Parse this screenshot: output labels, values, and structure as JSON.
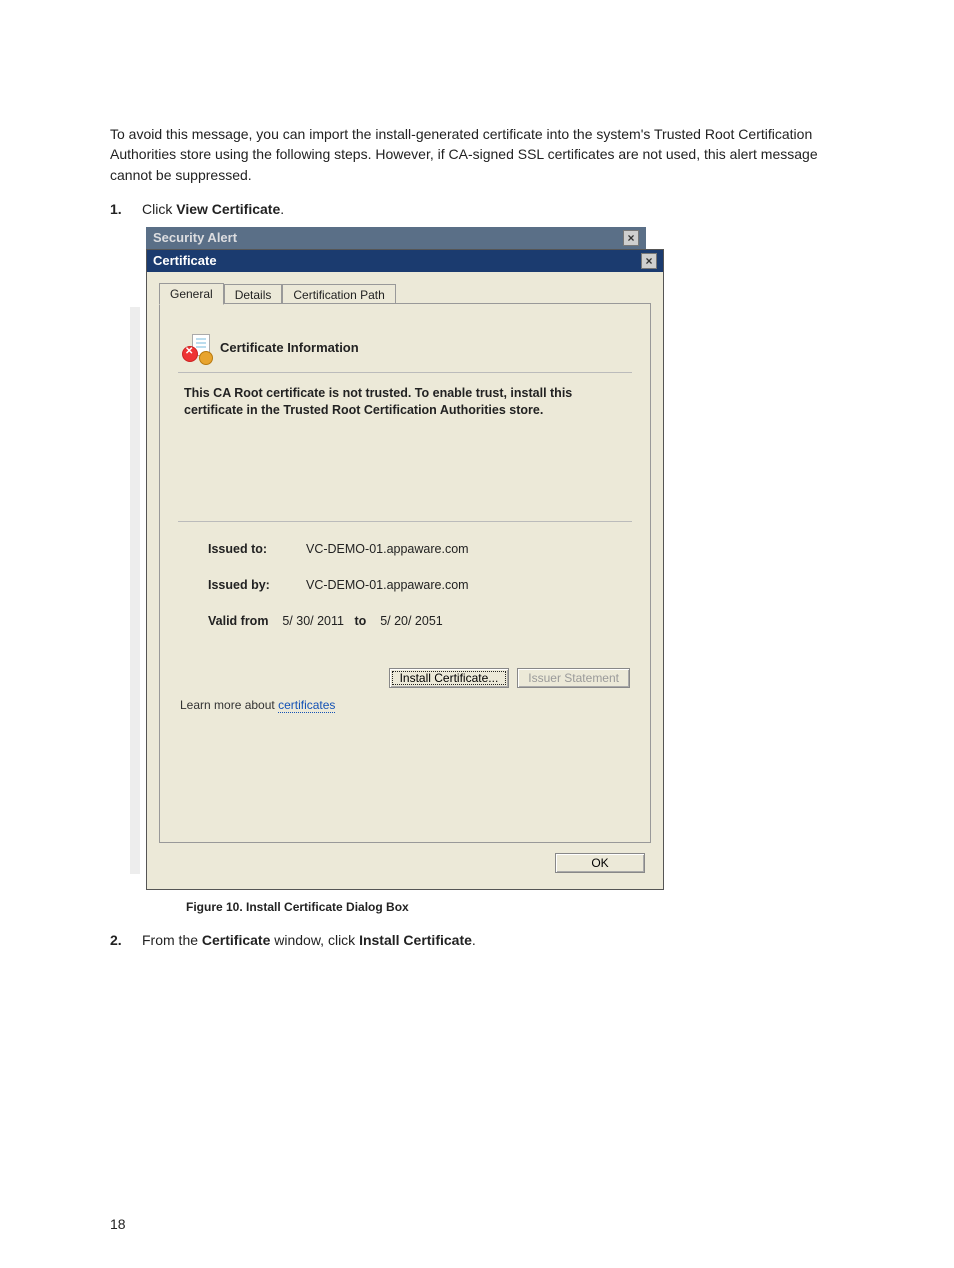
{
  "intro_text": "To avoid this message, you can import the install-generated certificate into the system's Trusted Root Certification Authorities store using the following steps. However, if CA-signed SSL certificates are not used, this alert message cannot be suppressed.",
  "steps": {
    "s1_num": "1.",
    "s1_prefix": "Click ",
    "s1_bold": "View Certificate",
    "s1_suffix": ".",
    "s2_num": "2.",
    "s2_prefix": "From the ",
    "s2_bold1": "Certificate",
    "s2_mid": " window, click ",
    "s2_bold2": "Install Certificate",
    "s2_suffix": "."
  },
  "caption": "Figure 10. Install Certificate Dialog Box",
  "page_number": "18",
  "bg_window": {
    "title": "Security Alert"
  },
  "dialog": {
    "title": "Certificate",
    "tabs": {
      "general": "General",
      "details": "Details",
      "certpath": "Certification Path"
    },
    "cert_info_heading": "Certificate Information",
    "trust_message": "This CA Root certificate is not trusted. To enable trust, install this certificate in the Trusted Root Certification Authorities store.",
    "issued_to_label": "Issued to:",
    "issued_to_value": "VC-DEMO-01.appaware.com",
    "issued_by_label": "Issued by:",
    "issued_by_value": "VC-DEMO-01.appaware.com",
    "valid_from_label": "Valid from",
    "valid_from_value": "5/ 30/ 2011",
    "valid_to_label": "to",
    "valid_to_value": "5/ 20/ 2051",
    "install_btn": "Install Certificate...",
    "issuer_btn": "Issuer Statement",
    "learn_prefix": "Learn more about ",
    "learn_link": "certificates",
    "ok_btn": "OK"
  }
}
